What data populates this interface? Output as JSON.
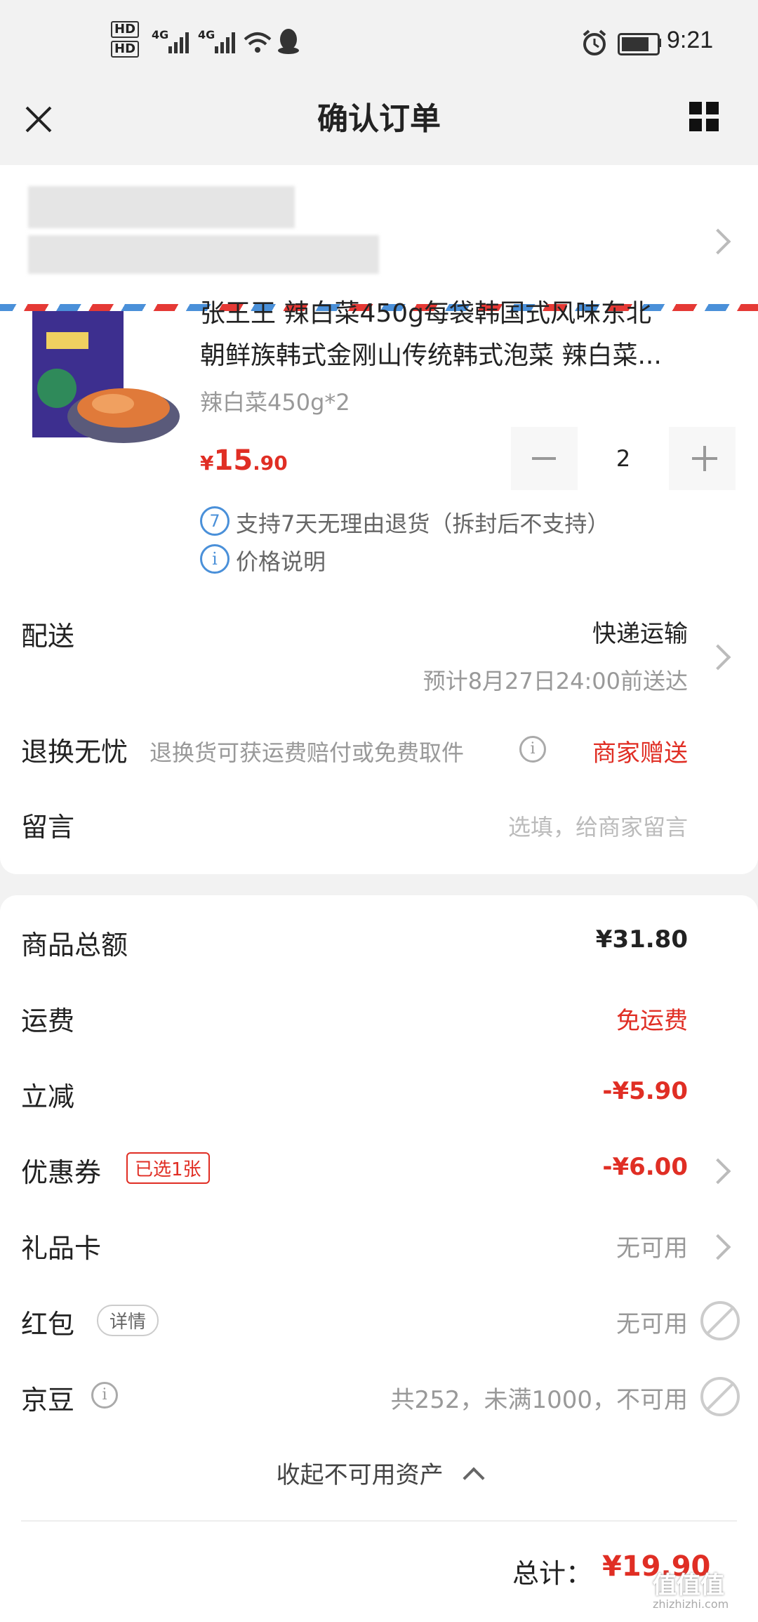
{
  "status_bar": {
    "hd1": "HD",
    "hd2": "HD",
    "sig1": "4G",
    "sig2": "4G",
    "time": "9:21"
  },
  "header": {
    "title": "确认订单"
  },
  "product": {
    "title_line1": "张王王 辣白菜450g每袋韩国式风味东北",
    "title_line2": "朝鲜族韩式金刚山传统韩式泡菜 辣白菜...",
    "spec": "辣白菜450g*2",
    "price_currency": "¥",
    "price_int": "15",
    "price_dec": ".90",
    "quantity": "2",
    "return_icon": "7",
    "return_text": "支持7天无理由退货（拆封后不支持）",
    "price_note": "价格说明"
  },
  "delivery": {
    "label": "配送",
    "method": "快递运输",
    "eta": "预计8月27日24:00前送达"
  },
  "worry_free": {
    "label": "退换无忧",
    "desc": "退换货可获运费赔付或免费取件",
    "value": "商家赠送"
  },
  "message": {
    "label": "留言",
    "placeholder": "选填，给商家留言"
  },
  "summary": {
    "goods_total_label": "商品总额",
    "goods_total": "¥31.80",
    "shipping_label": "运费",
    "shipping": "免运费",
    "discount_label": "立减",
    "discount": "-¥5.90",
    "coupon_label": "优惠券",
    "coupon_badge": "已选1张",
    "coupon": "-¥6.00",
    "giftcard_label": "礼品卡",
    "giftcard": "无可用",
    "redpacket_label": "红包",
    "redpacket_badge": "详情",
    "redpacket": "无可用",
    "jingdou_label": "京豆",
    "jingdou": "共252，未满1000，不可用",
    "collapse": "收起不可用资产"
  },
  "footer": {
    "total_label": "总计：",
    "total": "¥19.90",
    "watermark_cn": "值值值",
    "watermark_url": "zhizhizhi.com"
  },
  "colors": {
    "accent": "#e02e24",
    "background": "#f2f2f2"
  }
}
